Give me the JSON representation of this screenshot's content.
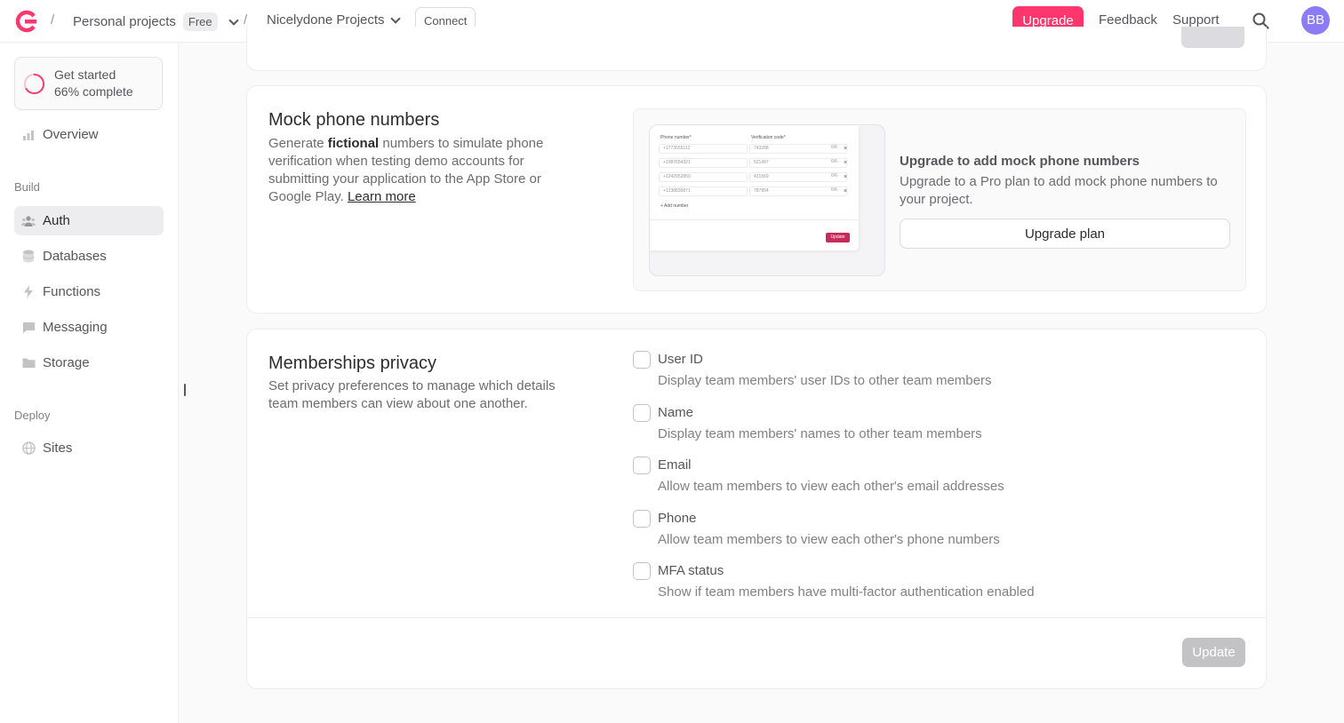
{
  "header": {
    "org_name": "Personal projects",
    "org_plan_badge": "Free",
    "project_name": "Nicelydone Projects",
    "connect_label": "Connect",
    "upgrade_label": "Upgrade",
    "feedback_label": "Feedback",
    "support_label": "Support",
    "avatar_initials": "BB",
    "separator": "/"
  },
  "sidebar": {
    "get_started": {
      "title": "Get started",
      "progress_text": "66% complete",
      "progress": 0.66
    },
    "overview_label": "Overview",
    "build_section": "Build",
    "build_items": [
      {
        "label": "Auth",
        "icon": "users-icon",
        "active": true
      },
      {
        "label": "Databases",
        "icon": "database-icon",
        "active": false
      },
      {
        "label": "Functions",
        "icon": "lightning-icon",
        "active": false
      },
      {
        "label": "Messaging",
        "icon": "chat-icon",
        "active": false
      },
      {
        "label": "Storage",
        "icon": "folder-icon",
        "active": false
      }
    ],
    "deploy_section": "Deploy",
    "deploy_items": [
      {
        "label": "Sites",
        "icon": "globe-icon"
      }
    ]
  },
  "mock_phone": {
    "title": "Mock phone numbers",
    "desc_before": "Generate ",
    "desc_bold": "fictional",
    "desc_after": " numbers to simulate phone verification when testing demo accounts for submitting your application to the App Store or Google Play. ",
    "learn_more": "Learn more",
    "preview": {
      "col_phone": "Phone number*",
      "col_code": "Verification code*",
      "rows": [
        {
          "phone": "+1773555112",
          "code": "743288"
        },
        {
          "phone": "+1987654321",
          "code": "521497"
        },
        {
          "phone": "+1242952859",
          "code": "431569"
        },
        {
          "phone": "+1238830871",
          "code": "787854"
        }
      ],
      "counter": "6/6",
      "remove_glyph": "×",
      "add_label": "Add number",
      "update_label": "Update"
    },
    "upsell_title": "Upgrade to add mock phone numbers",
    "upsell_desc": "Upgrade to a Pro plan to add mock phone numbers to your project.",
    "upgrade_plan_label": "Upgrade plan"
  },
  "memberships_privacy": {
    "title": "Memberships privacy",
    "desc": "Set privacy preferences to manage which details team members can view about one another.",
    "options": [
      {
        "label": "User ID",
        "desc": "Display team members' user IDs to other team members",
        "checked": false
      },
      {
        "label": "Name",
        "desc": "Display team members' names to other team members",
        "checked": false
      },
      {
        "label": "Email",
        "desc": "Allow team members to view each other's email addresses",
        "checked": false
      },
      {
        "label": "Phone",
        "desc": "Allow team members to view each other's phone numbers",
        "checked": false
      },
      {
        "label": "MFA status",
        "desc": "Show if team members have multi-factor authentication enabled",
        "checked": false
      }
    ],
    "update_label": "Update"
  },
  "colors": {
    "brand": "#fd366e",
    "avatar": "#8b7cf6",
    "disabled_button": "#c3c3c6"
  }
}
